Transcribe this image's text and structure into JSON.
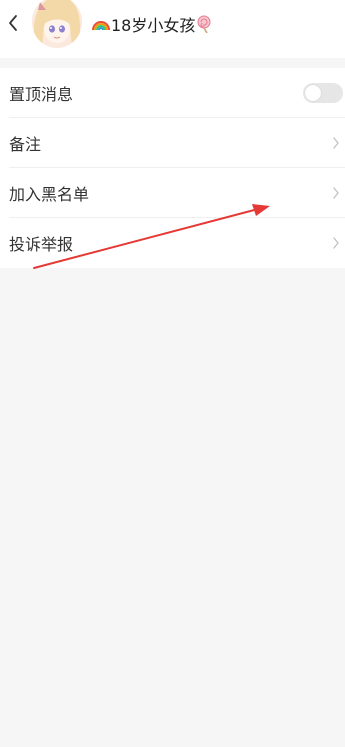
{
  "header": {
    "title": "18岁小女孩",
    "title_prefix_icon": "rainbow-icon",
    "title_suffix_icon": "lollipop-icon",
    "back_icon": "chevron-left-icon",
    "avatar": "anime-girl-avatar"
  },
  "settings": {
    "items": [
      {
        "label": "置顶消息",
        "control": "toggle",
        "toggle_on": false
      },
      {
        "label": "备注",
        "control": "chevron"
      },
      {
        "label": "加入黑名单",
        "control": "chevron"
      },
      {
        "label": "投诉举报",
        "control": "chevron"
      }
    ]
  },
  "annotation": {
    "type": "arrow",
    "color": "#e53935"
  },
  "colors": {
    "background": "#f6f6f6",
    "panel": "#ffffff",
    "toggle_off": "#e6e6e6",
    "chevron": "#c4c4c4"
  }
}
